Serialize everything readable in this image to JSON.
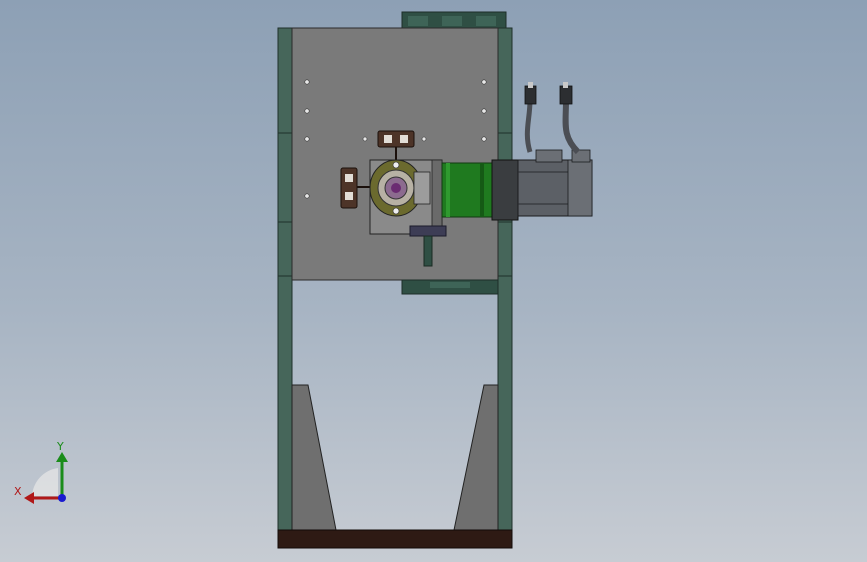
{
  "triad": {
    "y_label": "Y",
    "x_label": "X",
    "y_color": "#1a8c1a",
    "x_color": "#b01818",
    "z_color": "#1a1ad0"
  },
  "colors": {
    "background_top": "#8da0b5",
    "frame_green": "#3f5f52",
    "plate_gray": "#787878",
    "base_brown": "#2e1a14",
    "coupling_green": "#1f7a1f",
    "motor_gray": "#5c6066"
  }
}
